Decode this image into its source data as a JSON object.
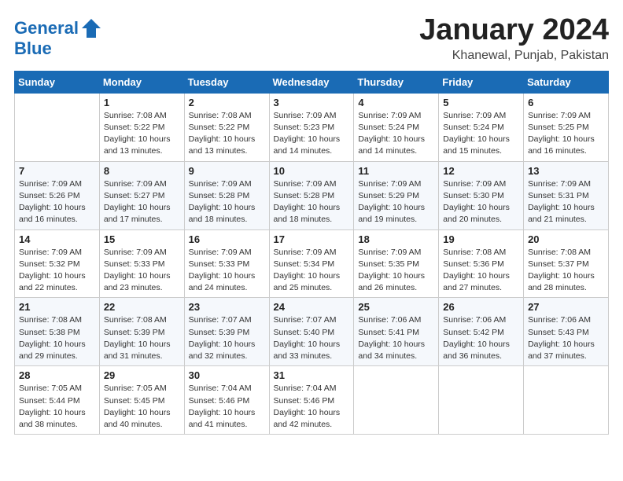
{
  "header": {
    "logo_line1": "General",
    "logo_line2": "Blue",
    "month": "January 2024",
    "location": "Khanewal, Punjab, Pakistan"
  },
  "days_of_week": [
    "Sunday",
    "Monday",
    "Tuesday",
    "Wednesday",
    "Thursday",
    "Friday",
    "Saturday"
  ],
  "weeks": [
    [
      {
        "num": "",
        "info": ""
      },
      {
        "num": "1",
        "info": "Sunrise: 7:08 AM\nSunset: 5:22 PM\nDaylight: 10 hours\nand 13 minutes."
      },
      {
        "num": "2",
        "info": "Sunrise: 7:08 AM\nSunset: 5:22 PM\nDaylight: 10 hours\nand 13 minutes."
      },
      {
        "num": "3",
        "info": "Sunrise: 7:09 AM\nSunset: 5:23 PM\nDaylight: 10 hours\nand 14 minutes."
      },
      {
        "num": "4",
        "info": "Sunrise: 7:09 AM\nSunset: 5:24 PM\nDaylight: 10 hours\nand 14 minutes."
      },
      {
        "num": "5",
        "info": "Sunrise: 7:09 AM\nSunset: 5:24 PM\nDaylight: 10 hours\nand 15 minutes."
      },
      {
        "num": "6",
        "info": "Sunrise: 7:09 AM\nSunset: 5:25 PM\nDaylight: 10 hours\nand 16 minutes."
      }
    ],
    [
      {
        "num": "7",
        "info": "Sunrise: 7:09 AM\nSunset: 5:26 PM\nDaylight: 10 hours\nand 16 minutes."
      },
      {
        "num": "8",
        "info": "Sunrise: 7:09 AM\nSunset: 5:27 PM\nDaylight: 10 hours\nand 17 minutes."
      },
      {
        "num": "9",
        "info": "Sunrise: 7:09 AM\nSunset: 5:28 PM\nDaylight: 10 hours\nand 18 minutes."
      },
      {
        "num": "10",
        "info": "Sunrise: 7:09 AM\nSunset: 5:28 PM\nDaylight: 10 hours\nand 18 minutes."
      },
      {
        "num": "11",
        "info": "Sunrise: 7:09 AM\nSunset: 5:29 PM\nDaylight: 10 hours\nand 19 minutes."
      },
      {
        "num": "12",
        "info": "Sunrise: 7:09 AM\nSunset: 5:30 PM\nDaylight: 10 hours\nand 20 minutes."
      },
      {
        "num": "13",
        "info": "Sunrise: 7:09 AM\nSunset: 5:31 PM\nDaylight: 10 hours\nand 21 minutes."
      }
    ],
    [
      {
        "num": "14",
        "info": "Sunrise: 7:09 AM\nSunset: 5:32 PM\nDaylight: 10 hours\nand 22 minutes."
      },
      {
        "num": "15",
        "info": "Sunrise: 7:09 AM\nSunset: 5:33 PM\nDaylight: 10 hours\nand 23 minutes."
      },
      {
        "num": "16",
        "info": "Sunrise: 7:09 AM\nSunset: 5:33 PM\nDaylight: 10 hours\nand 24 minutes."
      },
      {
        "num": "17",
        "info": "Sunrise: 7:09 AM\nSunset: 5:34 PM\nDaylight: 10 hours\nand 25 minutes."
      },
      {
        "num": "18",
        "info": "Sunrise: 7:09 AM\nSunset: 5:35 PM\nDaylight: 10 hours\nand 26 minutes."
      },
      {
        "num": "19",
        "info": "Sunrise: 7:08 AM\nSunset: 5:36 PM\nDaylight: 10 hours\nand 27 minutes."
      },
      {
        "num": "20",
        "info": "Sunrise: 7:08 AM\nSunset: 5:37 PM\nDaylight: 10 hours\nand 28 minutes."
      }
    ],
    [
      {
        "num": "21",
        "info": "Sunrise: 7:08 AM\nSunset: 5:38 PM\nDaylight: 10 hours\nand 29 minutes."
      },
      {
        "num": "22",
        "info": "Sunrise: 7:08 AM\nSunset: 5:39 PM\nDaylight: 10 hours\nand 31 minutes."
      },
      {
        "num": "23",
        "info": "Sunrise: 7:07 AM\nSunset: 5:39 PM\nDaylight: 10 hours\nand 32 minutes."
      },
      {
        "num": "24",
        "info": "Sunrise: 7:07 AM\nSunset: 5:40 PM\nDaylight: 10 hours\nand 33 minutes."
      },
      {
        "num": "25",
        "info": "Sunrise: 7:06 AM\nSunset: 5:41 PM\nDaylight: 10 hours\nand 34 minutes."
      },
      {
        "num": "26",
        "info": "Sunrise: 7:06 AM\nSunset: 5:42 PM\nDaylight: 10 hours\nand 36 minutes."
      },
      {
        "num": "27",
        "info": "Sunrise: 7:06 AM\nSunset: 5:43 PM\nDaylight: 10 hours\nand 37 minutes."
      }
    ],
    [
      {
        "num": "28",
        "info": "Sunrise: 7:05 AM\nSunset: 5:44 PM\nDaylight: 10 hours\nand 38 minutes."
      },
      {
        "num": "29",
        "info": "Sunrise: 7:05 AM\nSunset: 5:45 PM\nDaylight: 10 hours\nand 40 minutes."
      },
      {
        "num": "30",
        "info": "Sunrise: 7:04 AM\nSunset: 5:46 PM\nDaylight: 10 hours\nand 41 minutes."
      },
      {
        "num": "31",
        "info": "Sunrise: 7:04 AM\nSunset: 5:46 PM\nDaylight: 10 hours\nand 42 minutes."
      },
      {
        "num": "",
        "info": ""
      },
      {
        "num": "",
        "info": ""
      },
      {
        "num": "",
        "info": ""
      }
    ]
  ]
}
